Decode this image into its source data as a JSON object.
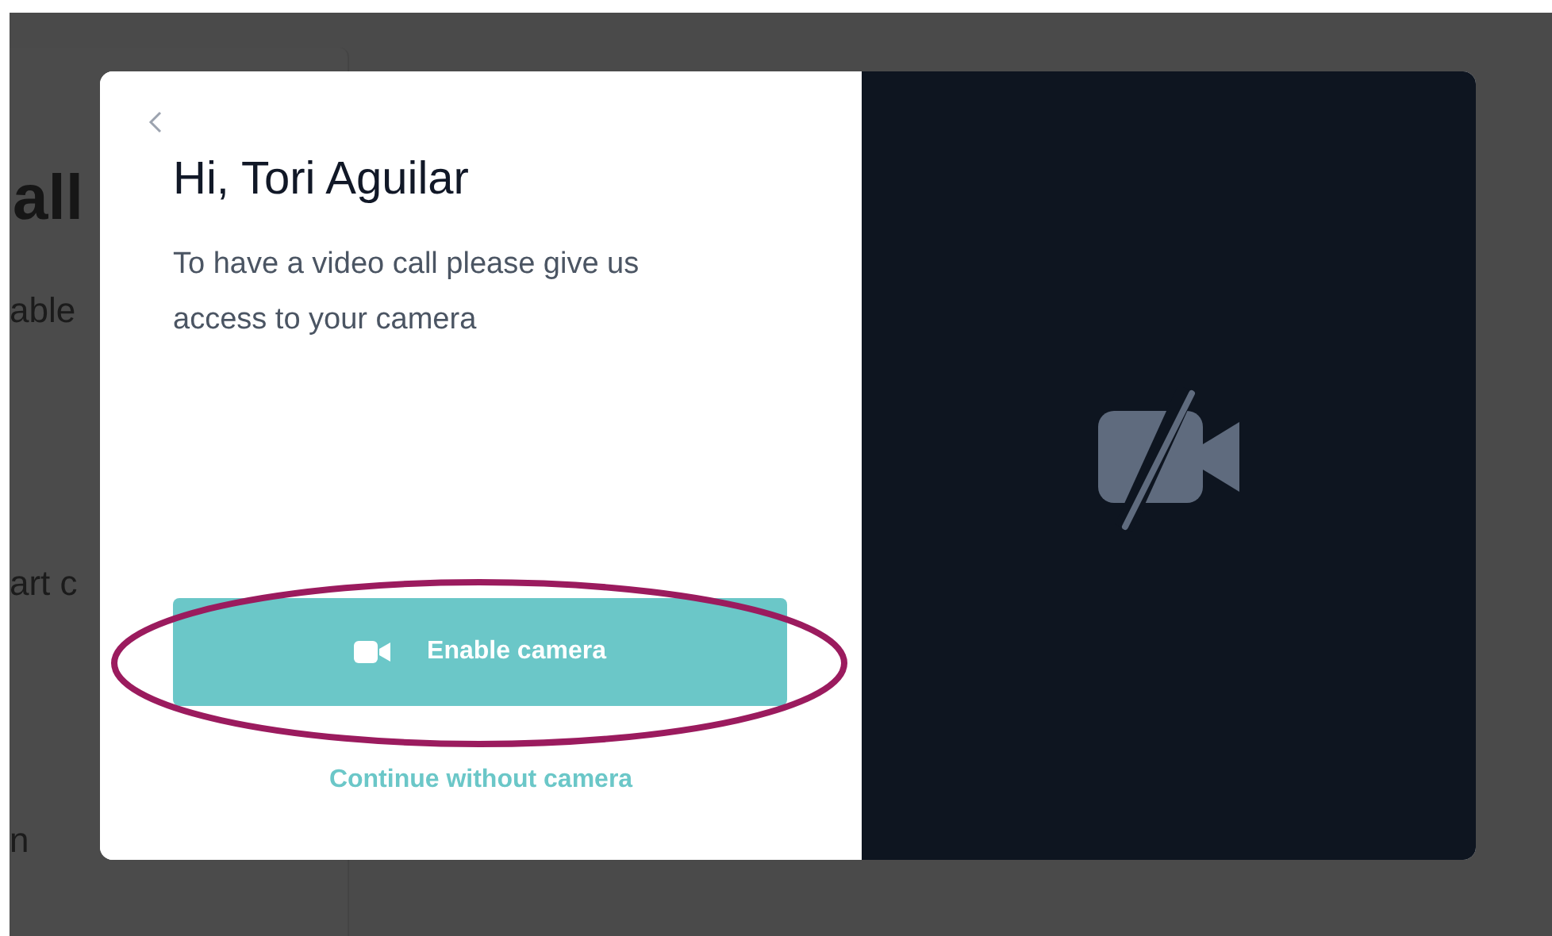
{
  "background_page": {
    "heading": "all",
    "lines": [
      "able",
      "art c",
      "n"
    ]
  },
  "modal": {
    "title": "Hi, Tori Aguilar",
    "message": "To have a video call please give us access to your camera",
    "actions": [
      {
        "kind": "primary",
        "label": "Enable camera"
      },
      {
        "kind": "link",
        "label": "Continue without camera"
      }
    ]
  }
}
